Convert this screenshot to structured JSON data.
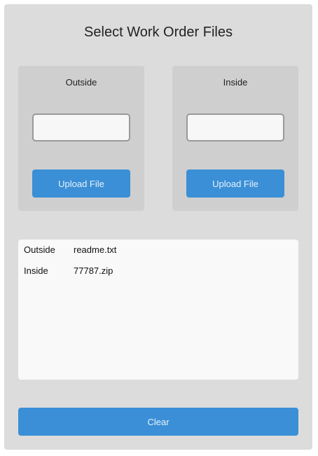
{
  "title": "Select Work Order Files",
  "outside": {
    "label": "Outside",
    "input_value": "",
    "upload_label": "Upload File"
  },
  "inside": {
    "label": "Inside",
    "input_value": "",
    "upload_label": "Upload File"
  },
  "files": [
    {
      "side": "Outside",
      "name": "readme.txt"
    },
    {
      "side": "Inside",
      "name": "77787.zip"
    }
  ],
  "clear_label": "Clear",
  "colors": {
    "panel_bg": "#dcdcdc",
    "card_bg": "#cfcfcf",
    "accent": "#3a8fd6",
    "list_bg": "#f9f9f9"
  }
}
